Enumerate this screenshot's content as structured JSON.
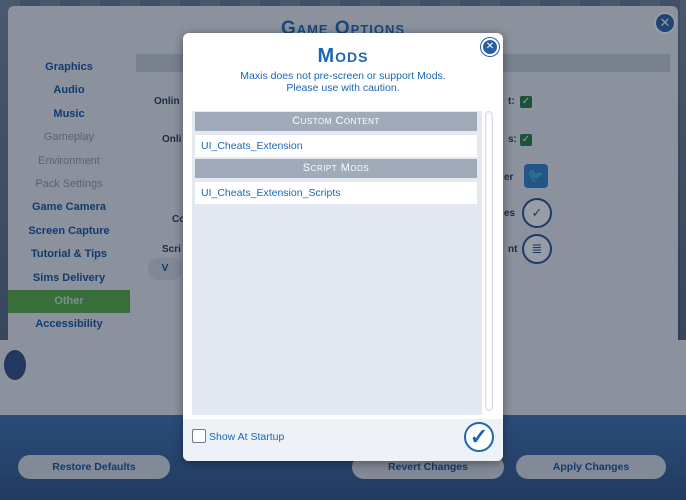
{
  "game_options": {
    "title": "Game Options",
    "close_icon": "close-icon",
    "sidebar": [
      {
        "label": "Graphics",
        "state": "normal"
      },
      {
        "label": "Audio",
        "state": "normal"
      },
      {
        "label": "Music",
        "state": "normal"
      },
      {
        "label": "Gameplay",
        "state": "dim"
      },
      {
        "label": "Environment",
        "state": "dim"
      },
      {
        "label": "Pack Settings",
        "state": "dim"
      },
      {
        "label": "Game Camera",
        "state": "normal"
      },
      {
        "label": "Screen Capture",
        "state": "normal"
      },
      {
        "label": "Tutorial & Tips",
        "state": "normal"
      },
      {
        "label": "Sims Delivery",
        "state": "normal"
      },
      {
        "label": "Other",
        "state": "active"
      },
      {
        "label": "Accessibility",
        "state": "normal"
      }
    ],
    "content_labels": {
      "online1": "Onlin",
      "online2": "Onli",
      "co": "Co",
      "scri": "Scri",
      "view": "V",
      "r1": "t:",
      "r2": "s:",
      "r3": "er",
      "r4": "es",
      "r5": "nt"
    },
    "buttons": {
      "restore": "Restore Defaults",
      "revert": "Revert Changes",
      "apply": "Apply Changes"
    },
    "accent_active": "#52a941"
  },
  "mods_dialog": {
    "title": "Mods",
    "subtitle_line1": "Maxis does not pre-screen or support Mods.",
    "subtitle_line2": "Please use with caution.",
    "sections": [
      {
        "header": "Custom Content",
        "items": [
          "UI_Cheats_Extension"
        ]
      },
      {
        "header": "Script Mods",
        "items": [
          "UI_Cheats_Extension_Scripts"
        ]
      }
    ],
    "show_at_startup_label": "Show At Startup",
    "show_at_startup_checked": false,
    "ok_icon": "checkmark-icon",
    "accent": "#1b67b5"
  }
}
